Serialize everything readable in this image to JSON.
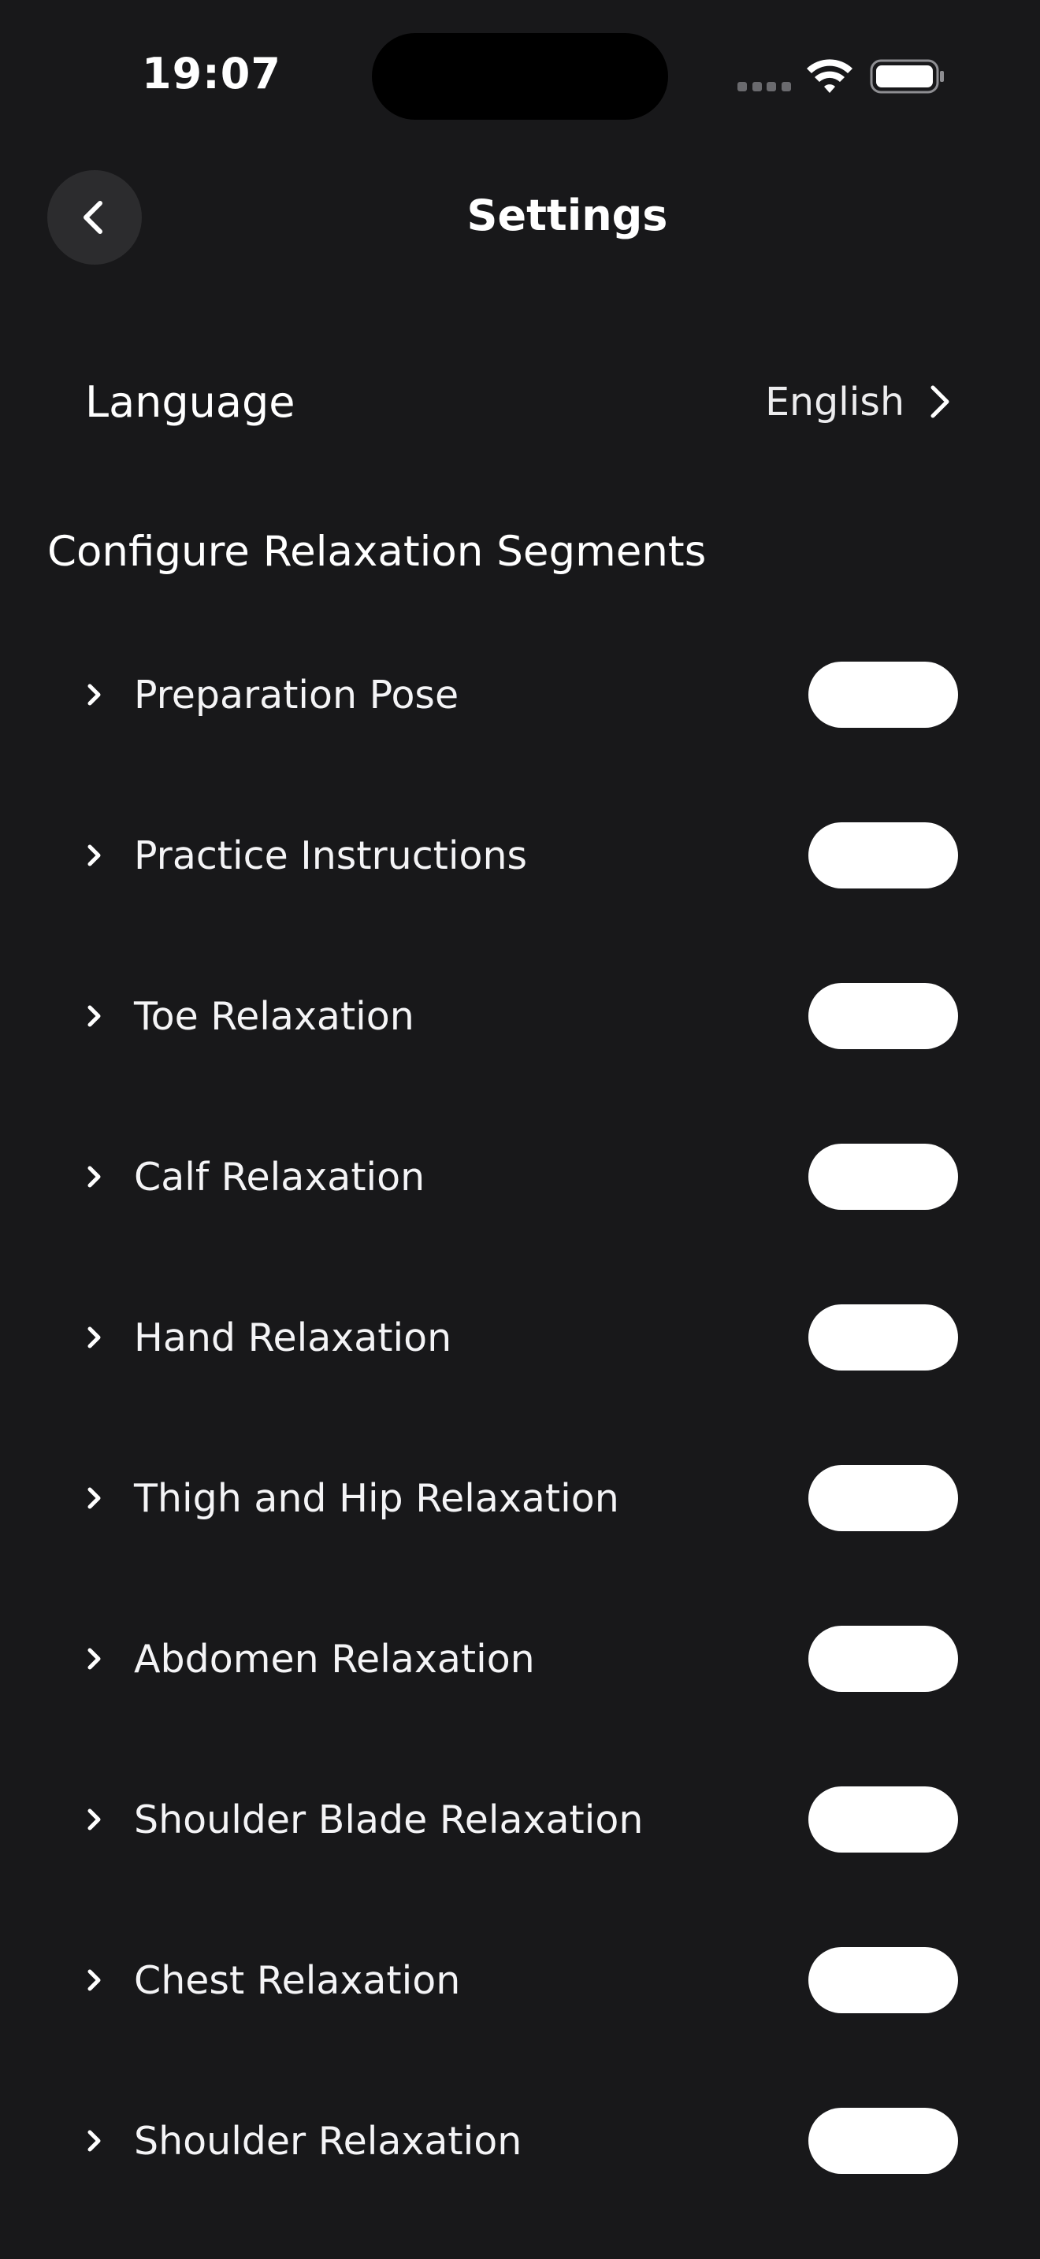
{
  "status_bar": {
    "time": "19:07"
  },
  "header": {
    "title": "Settings",
    "back_icon": "chevron-left-icon"
  },
  "language": {
    "label": "Language",
    "value": "English"
  },
  "section": {
    "title": "Configure Relaxation Segments"
  },
  "segments": [
    {
      "label": "Preparation Pose",
      "enabled": true
    },
    {
      "label": "Practice Instructions",
      "enabled": true
    },
    {
      "label": "Toe Relaxation",
      "enabled": true
    },
    {
      "label": "Calf Relaxation",
      "enabled": true
    },
    {
      "label": "Hand Relaxation",
      "enabled": true
    },
    {
      "label": "Thigh and Hip Relaxation",
      "enabled": true
    },
    {
      "label": "Abdomen Relaxation",
      "enabled": true
    },
    {
      "label": "Shoulder Blade Relaxation",
      "enabled": true
    },
    {
      "label": "Chest Relaxation",
      "enabled": true
    },
    {
      "label": "Shoulder Relaxation",
      "enabled": true
    }
  ],
  "colors": {
    "background": "#18181a",
    "toggle": "#ffffff",
    "back_button": "#2c2c2e"
  }
}
